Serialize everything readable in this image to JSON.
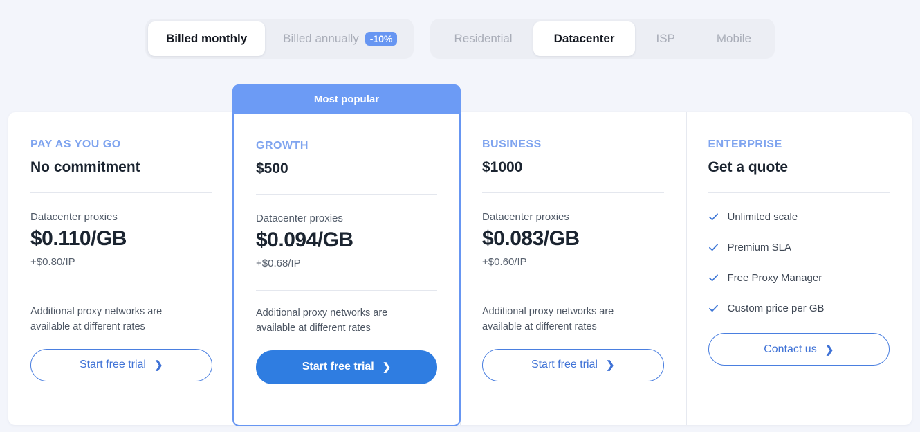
{
  "billing_toggle": {
    "options": [
      {
        "label": "Billed monthly",
        "active": true,
        "badge": ""
      },
      {
        "label": "Billed annually",
        "active": false,
        "badge": "-10%"
      }
    ]
  },
  "proxy_type_tabs": {
    "options": [
      {
        "label": "Residential",
        "active": false
      },
      {
        "label": "Datacenter",
        "active": true
      },
      {
        "label": "ISP",
        "active": false
      },
      {
        "label": "Mobile",
        "active": false
      }
    ]
  },
  "plans": [
    {
      "tier": "PAY AS YOU GO",
      "headline": "No commitment",
      "proxy_label": "Datacenter proxies",
      "price": "$0.110/GB",
      "ip_price": "+$0.80/IP",
      "note": "Additional proxy networks are available at different rates",
      "cta": "Start free trial"
    },
    {
      "banner": "Most popular",
      "tier": "GROWTH",
      "headline": "$500",
      "proxy_label": "Datacenter proxies",
      "price": "$0.094/GB",
      "ip_price": "+$0.68/IP",
      "note": "Additional proxy networks are available at different rates",
      "cta": "Start free trial"
    },
    {
      "tier": "BUSINESS",
      "headline": "$1000",
      "proxy_label": "Datacenter proxies",
      "price": "$0.083/GB",
      "ip_price": "+$0.60/IP",
      "note": "Additional proxy networks are available at different rates",
      "cta": "Start free trial"
    },
    {
      "tier": "ENTERPRISE",
      "headline": "Get a quote",
      "features": [
        "Unlimited scale",
        "Premium SLA",
        "Free Proxy Manager",
        "Custom price per GB"
      ],
      "cta": "Contact us"
    }
  ],
  "icons": {
    "check": "check-icon",
    "chevron": "chevron-right-icon"
  },
  "colors": {
    "page_bg": "#f3f5fb",
    "accent": "#6796f2",
    "tier_text": "#7fa4ef",
    "cta_outline": "#4a7fe0",
    "cta_filled": "#2f7de1",
    "banner": "#6c9bf5",
    "badge": "#6796f2"
  }
}
